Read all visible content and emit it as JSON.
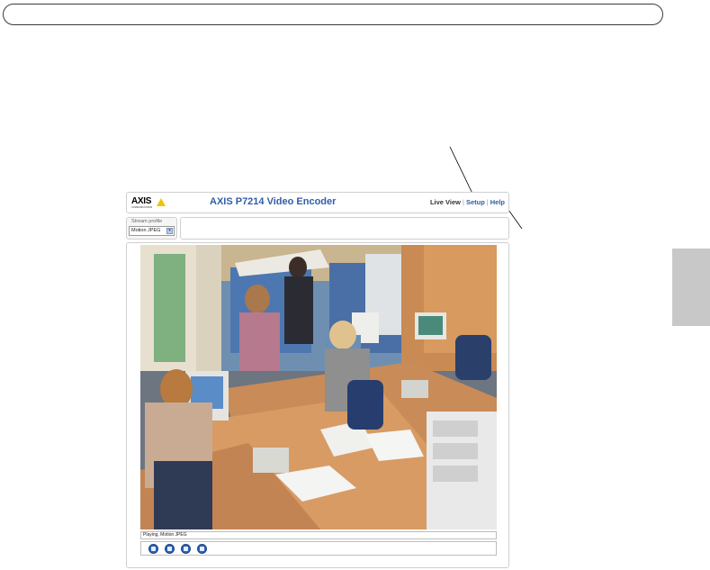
{
  "header": {
    "logo_text": "AXIS",
    "logo_sub": "COMMUNICATIONS",
    "title": "AXIS P7214 Video Encoder",
    "nav": {
      "live_view": "Live View",
      "setup": "Setup",
      "help": "Help"
    }
  },
  "stream": {
    "label": "Stream profile",
    "selected": "Motion JPEG"
  },
  "status": {
    "text": "Playing, Motion JPEG"
  },
  "controls": [
    {
      "icon": "stop-icon"
    },
    {
      "icon": "snapshot-icon"
    },
    {
      "icon": "audio-icon"
    },
    {
      "icon": "fullscreen-icon"
    }
  ],
  "colors": {
    "accent": "#2f5ea8",
    "button": "#2b62b8",
    "logo_triangle": "#f2c200"
  }
}
